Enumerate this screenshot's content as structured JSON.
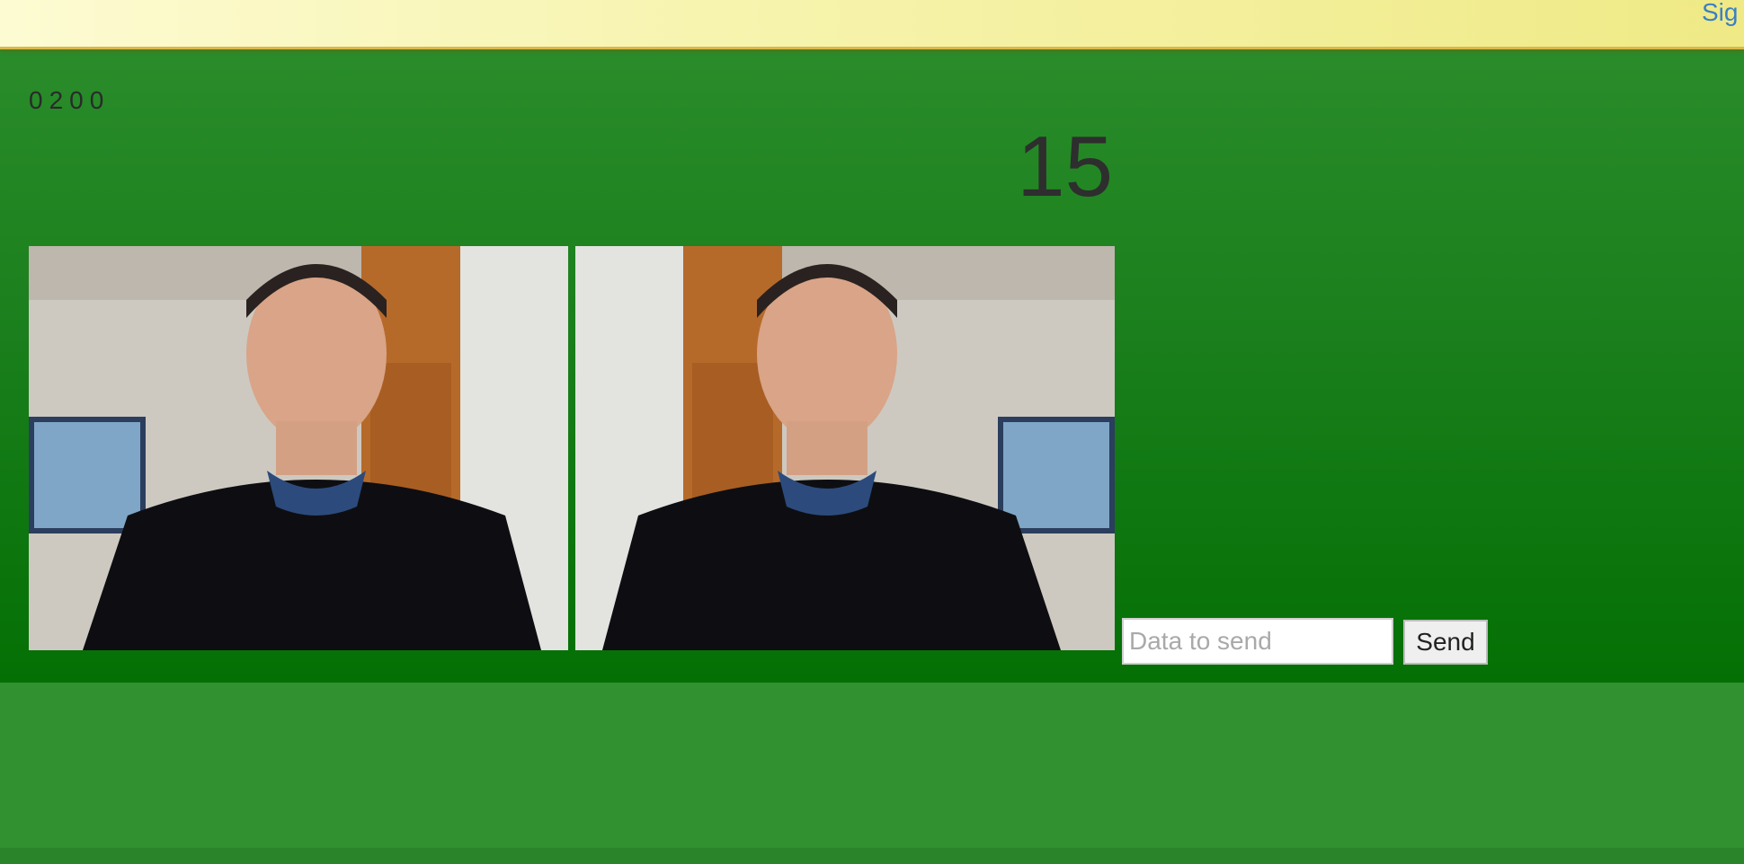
{
  "header": {
    "signin_label": "Sig"
  },
  "code": "0200",
  "counter": "15",
  "videos": {
    "local_label": "local-video",
    "remote_label": "remote-video"
  },
  "send_form": {
    "placeholder": "Data to send",
    "value": "",
    "send_label": "Send"
  },
  "colors": {
    "topbar": "#f7f4b0",
    "main_green": "#1a7f1c",
    "lower_green": "#31902f",
    "link_blue": "#3b7fc4"
  }
}
